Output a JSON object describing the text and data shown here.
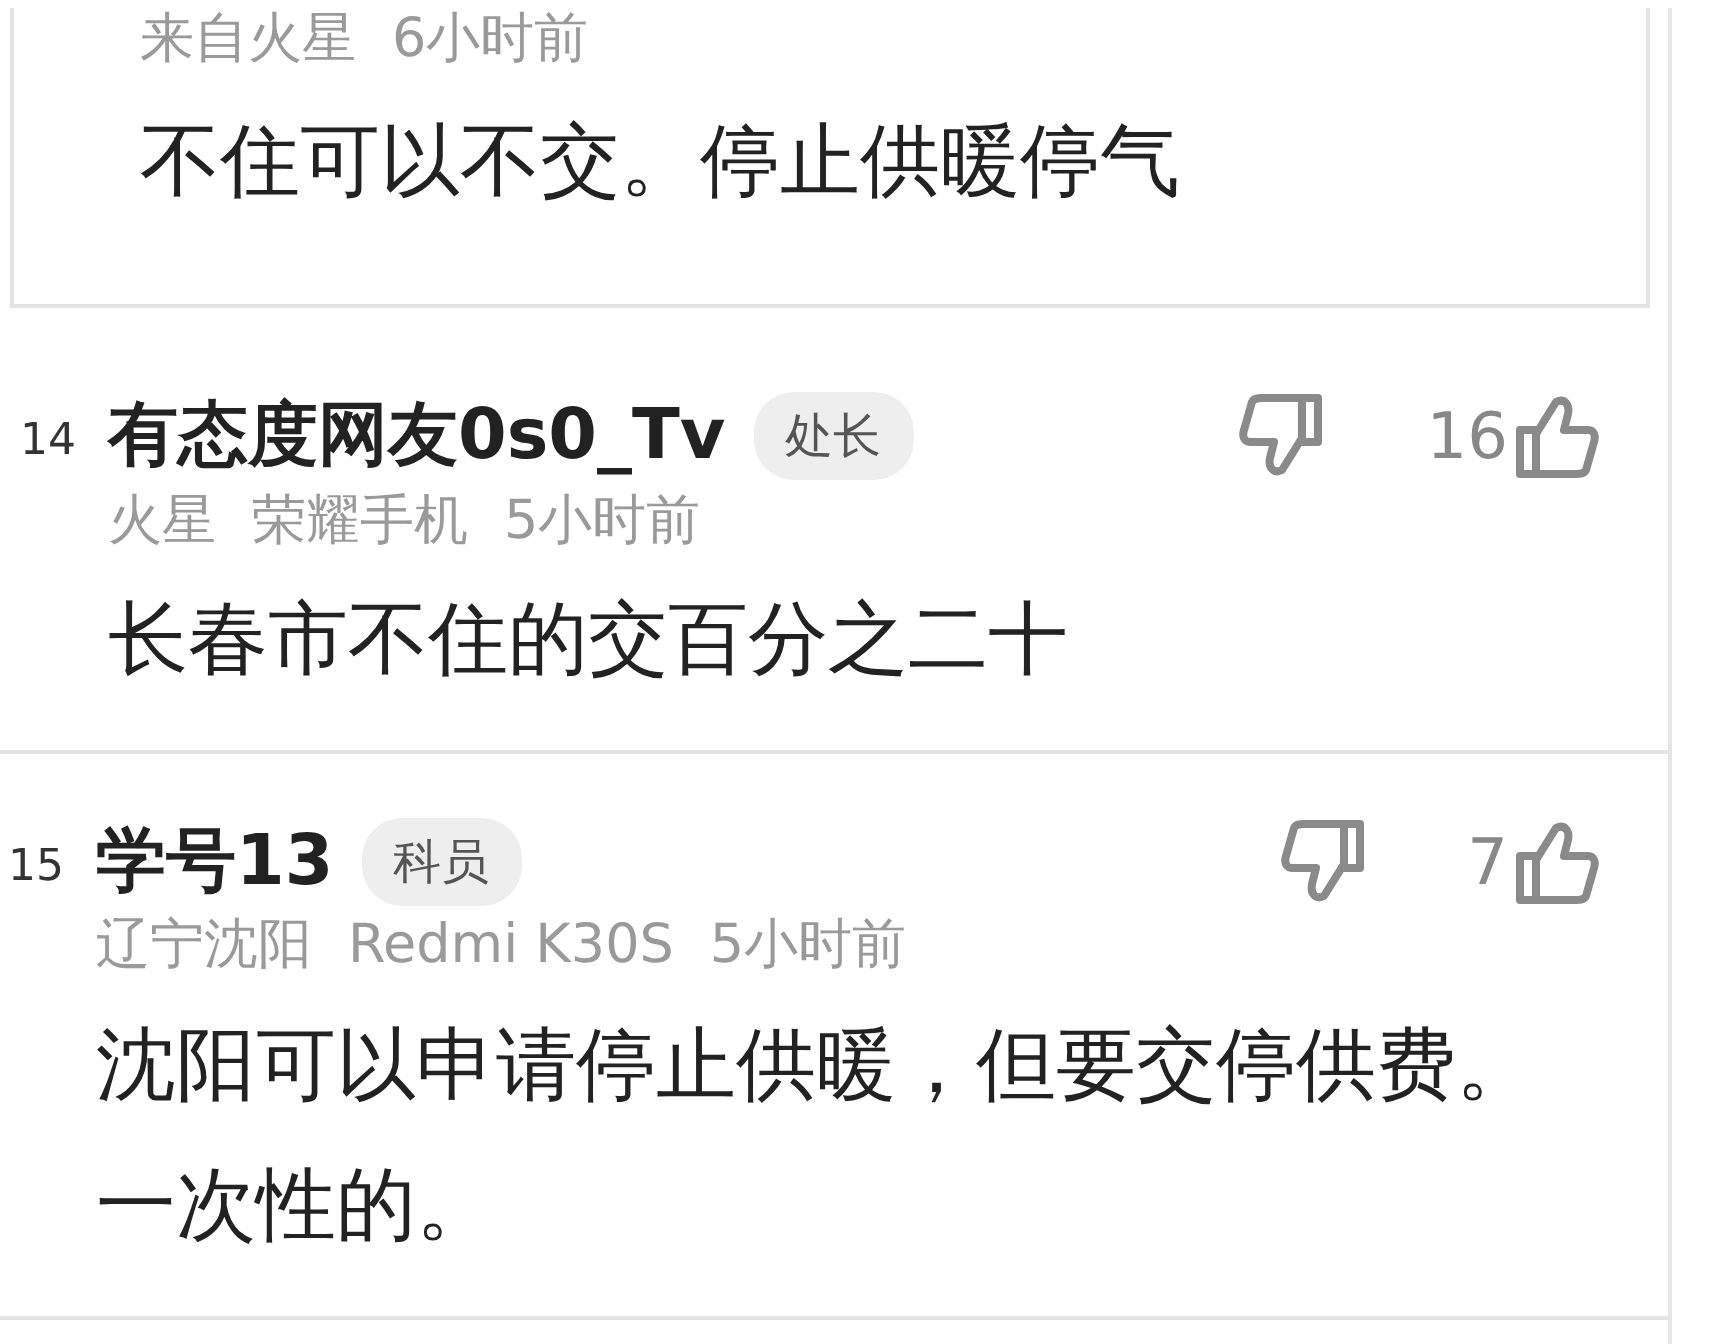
{
  "partial_comment": {
    "meta": [
      "来自火星",
      "6小时前"
    ],
    "text": "不住可以不交。停止供暖停气"
  },
  "comments": [
    {
      "floor": "14",
      "name": "有态度网友0s0_Tv",
      "badge": "处长",
      "meta": [
        "火星",
        "荣耀手机",
        "5小时前"
      ],
      "likes": "16",
      "text": "长春市不住的交百分之二十"
    },
    {
      "floor": "15",
      "name": "学号13",
      "badge": "科员",
      "meta": [
        "辽宁沈阳",
        "Redmi K30S",
        "5小时前"
      ],
      "likes": "7",
      "text": "沈阳可以申请停止供暖，但要交停供费。一次性的。"
    }
  ]
}
